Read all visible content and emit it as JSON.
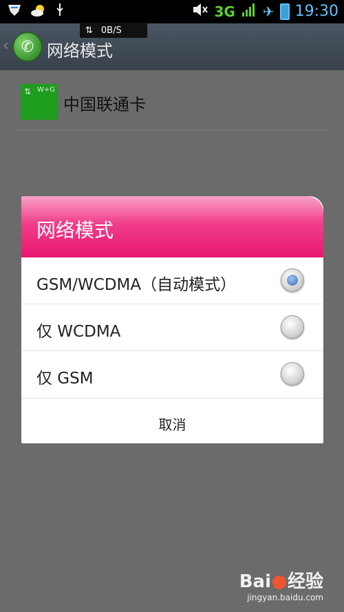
{
  "statusbar": {
    "network_speed": "0B/S",
    "network_speed_arrows": "⇅",
    "network_type": "3G",
    "time": "19:30",
    "accent_color": "#5ec3ff"
  },
  "actionbar": {
    "title": "网络模式",
    "back_glyph": "‹",
    "icon": "phone-icon"
  },
  "sim": {
    "label": "中国联通卡",
    "icon_badge": "W+G",
    "icon_arrows": "⇅"
  },
  "dialog": {
    "title": "网络模式",
    "options": [
      {
        "label": "GSM/WCDMA（自动模式）",
        "selected": true
      },
      {
        "label": "仅 WCDMA",
        "selected": false
      },
      {
        "label": "仅 GSM",
        "selected": false
      }
    ],
    "cancel_label": "取消",
    "header_color": "#ec2a7b"
  },
  "watermark": {
    "brand": "Bai",
    "brand_suffix": "经验",
    "url": "jingyan.baidu.com"
  }
}
